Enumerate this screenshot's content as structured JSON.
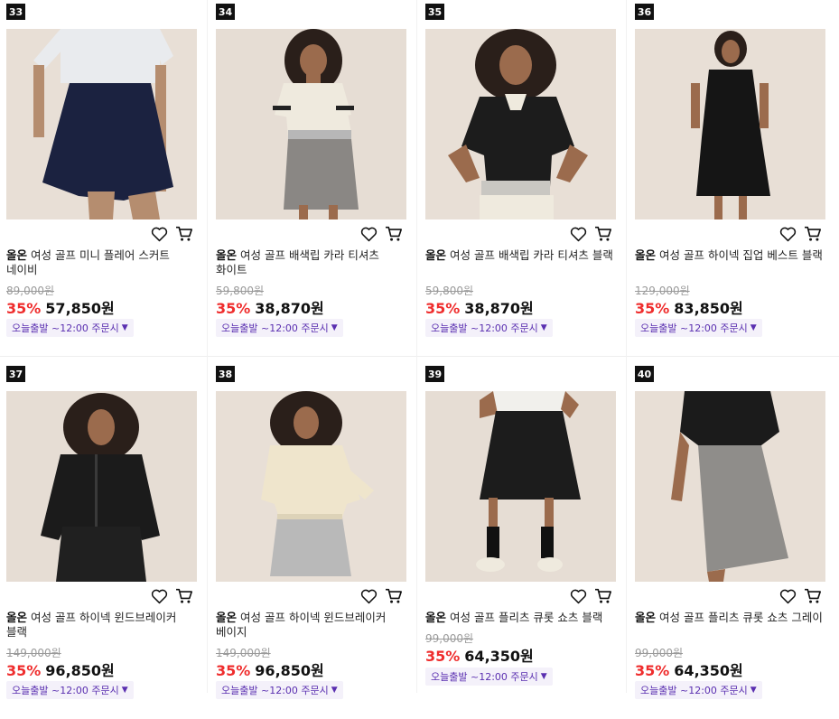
{
  "colors": {
    "discount": "#ef2d2d",
    "ship_text": "#5a2fb0",
    "ship_bg": "#f4f1fa"
  },
  "products": [
    {
      "rank": "33",
      "brand": "올온",
      "name": "여성 골프 미니 플레어 스커트 네이비",
      "original_price": "89,000원",
      "discount": "35%",
      "price": "57,850원",
      "shipping": "오늘출발 ~12:00 주문시"
    },
    {
      "rank": "34",
      "brand": "올온",
      "name": "여성 골프 배색립 카라 티셔츠 화이트",
      "original_price": "59,800원",
      "discount": "35%",
      "price": "38,870원",
      "shipping": "오늘출발 ~12:00 주문시"
    },
    {
      "rank": "35",
      "brand": "올온",
      "name": "여성 골프 배색립 카라 티셔츠 블랙",
      "original_price": "59,800원",
      "discount": "35%",
      "price": "38,870원",
      "shipping": "오늘출발 ~12:00 주문시"
    },
    {
      "rank": "36",
      "brand": "올온",
      "name": "여성 골프 하이넥 집업 베스트 블랙",
      "original_price": "129,000원",
      "discount": "35%",
      "price": "83,850원",
      "shipping": "오늘출발 ~12:00 주문시"
    },
    {
      "rank": "37",
      "brand": "올온",
      "name": "여성 골프 하이넥 윈드브레이커 블랙",
      "original_price": "149,000원",
      "discount": "35%",
      "price": "96,850원",
      "shipping": "오늘출발 ~12:00 주문시"
    },
    {
      "rank": "38",
      "brand": "올온",
      "name": "여성 골프 하이넥 윈드브레이커 베이지",
      "original_price": "149,000원",
      "discount": "35%",
      "price": "96,850원",
      "shipping": "오늘출발 ~12:00 주문시"
    },
    {
      "rank": "39",
      "brand": "올온",
      "name": "여성 골프 플리츠 큐롯 쇼츠 블랙",
      "original_price": "99,000원",
      "discount": "35%",
      "price": "64,350원",
      "shipping": "오늘출발 ~12:00 주문시"
    },
    {
      "rank": "40",
      "brand": "올온",
      "name": "여성 골프 플리츠 큐롯 쇼츠 그레이",
      "original_price": "99,000원",
      "discount": "35%",
      "price": "64,350원",
      "shipping": "오늘출발 ~12:00 주문시"
    }
  ],
  "icons": {
    "wishlist": "heart-outline-icon",
    "cart": "cart-icon",
    "dropdown": "caret-down-icon"
  }
}
